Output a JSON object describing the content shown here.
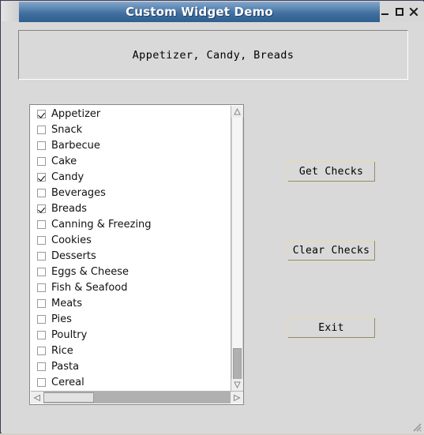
{
  "window": {
    "title": "Custom Widget Demo",
    "controls": [
      {
        "name": "minimize-button",
        "glyph": "minimize"
      },
      {
        "name": "maximize-button",
        "glyph": "maximize"
      },
      {
        "name": "close-button",
        "glyph": "close"
      }
    ]
  },
  "status_label": {
    "text": "Appetizer, Candy, Breads"
  },
  "checklist": {
    "items": [
      {
        "label": "Appetizer",
        "checked": true
      },
      {
        "label": "Snack",
        "checked": false
      },
      {
        "label": "Barbecue",
        "checked": false
      },
      {
        "label": "Cake",
        "checked": false
      },
      {
        "label": "Candy",
        "checked": true
      },
      {
        "label": "Beverages",
        "checked": false
      },
      {
        "label": "Breads",
        "checked": true
      },
      {
        "label": "Canning & Freezing",
        "checked": false
      },
      {
        "label": "Cookies",
        "checked": false
      },
      {
        "label": "Desserts",
        "checked": false
      },
      {
        "label": "Eggs & Cheese",
        "checked": false
      },
      {
        "label": "Fish & Seafood",
        "checked": false
      },
      {
        "label": "Meats",
        "checked": false
      },
      {
        "label": "Pies",
        "checked": false
      },
      {
        "label": "Poultry",
        "checked": false
      },
      {
        "label": "Rice",
        "checked": false
      },
      {
        "label": "Pasta",
        "checked": false
      },
      {
        "label": "Cereal",
        "checked": false
      }
    ]
  },
  "scrollbars": {
    "vertical": {
      "up_icon": "triangle-up-icon",
      "down_icon": "triangle-down-icon"
    },
    "horizontal": {
      "left_icon": "triangle-left-icon",
      "right_icon": "triangle-right-icon"
    }
  },
  "buttons": {
    "get_checks": "Get Checks",
    "clear_checks": "Clear Checks",
    "exit": "Exit"
  },
  "colors": {
    "title_bar_top": "#7ea2c6",
    "title_bar_bottom": "#2f5e90",
    "panel_background": "#d9d9d9",
    "list_background": "#ffffff",
    "button_highlight": "#e8d9b0",
    "window_border": "#3a3a5c"
  }
}
